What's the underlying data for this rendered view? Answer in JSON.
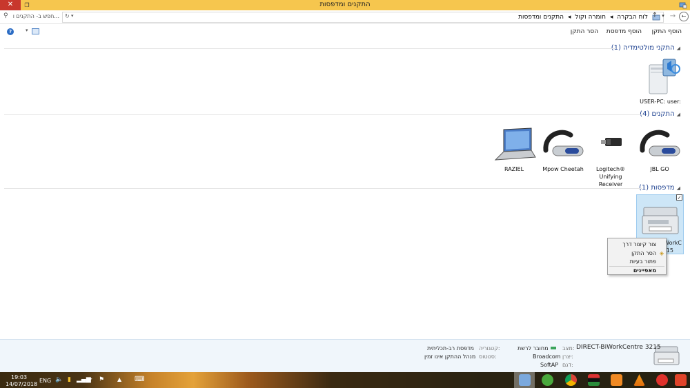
{
  "window": {
    "title": "התקנים ומדפסות",
    "close_glyph": "✕",
    "restore_glyph": "❐"
  },
  "address": {
    "search_placeholder": "חפש ב- התקנים ו...",
    "crumbs": [
      "לוח הבקרה",
      "חומרה וקול",
      "התקנים ומדפסות"
    ],
    "crumb_sep": "◂"
  },
  "toolbar": {
    "add_device": "הוסף התקן",
    "add_printer": "הוסף מדפסת",
    "remove_device": "הסר התקן",
    "help": "?"
  },
  "groups": {
    "multimedia": {
      "title": "התקני מולטימדיה (1)",
      "devices": [
        {
          "label": "USER-PC: user:"
        }
      ]
    },
    "devices": {
      "title": "התקנים (4)",
      "devices": [
        {
          "label": "JBL GO"
        },
        {
          "label": "Logitech®",
          "label2": "Unifying Receiver"
        },
        {
          "label": "Mpow Cheetah"
        },
        {
          "label": "RAZIEL"
        }
      ]
    },
    "printers": {
      "title": "מדפסות (1)",
      "devices": [
        {
          "label_frag1": "WorkC",
          "label_frag2": "215"
        }
      ]
    }
  },
  "context_menu": {
    "items": [
      "צור קיצור דרך",
      "הסר התקן",
      "פתור בעיות",
      "מאפיינים"
    ]
  },
  "details": {
    "name": "DIRECT-BiWorkCentre 3215",
    "status_key": "מצב:",
    "status_val": "מחובר לרשת",
    "manufacturer_key": "יצרן:",
    "manufacturer_val": "Broadcom",
    "model_key": "דגם:",
    "model_val": "SoftAP",
    "category_key": "קטגוריה:",
    "category_val": "מדפסת רב-תכליתית",
    "state_key": "סטטוס:",
    "state_val": "מנהל ההתקן אינו זמין"
  },
  "taskbar": {
    "time": "19:03",
    "date": "14/07/2018",
    "lang": "ENG"
  },
  "colors": {
    "titlebar": "#f6c64e",
    "close": "#c8372d",
    "group_header": "#1b3f8f",
    "selection": "#cde6f7"
  }
}
